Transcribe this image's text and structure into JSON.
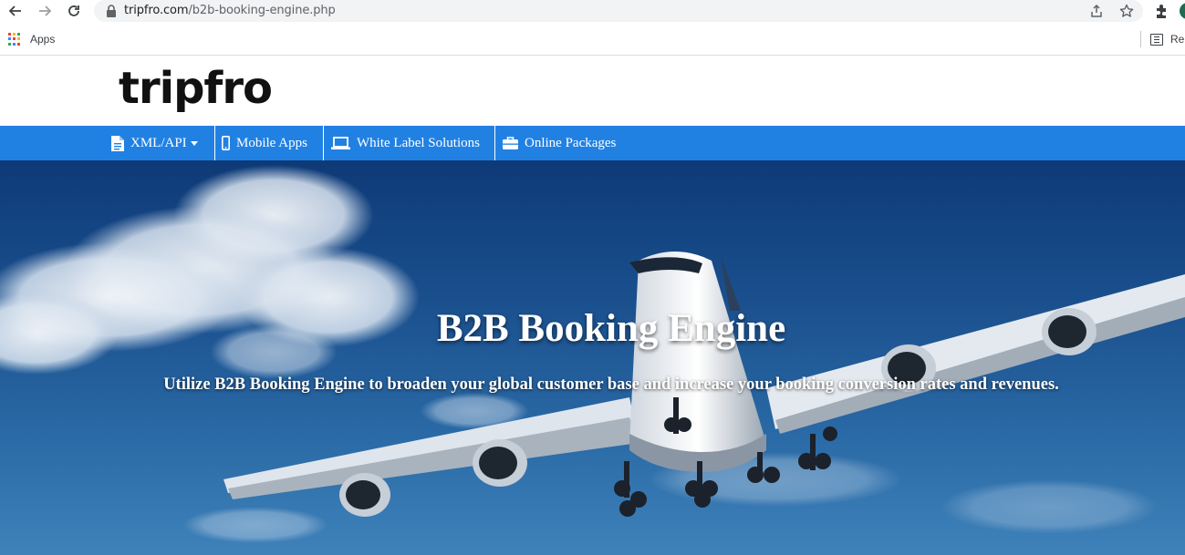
{
  "browser": {
    "url_host": "tripfro.com",
    "url_path": "/b2b-booking-engine.php",
    "bookmarks": {
      "apps_label": "Apps",
      "reading_list_label": "Re"
    },
    "icons": [
      "back-icon",
      "forward-icon",
      "reload-icon",
      "lock-icon",
      "share-icon",
      "star-icon",
      "extensions-icon",
      "apps-grid-icon",
      "reading-list-icon"
    ]
  },
  "site": {
    "logo": "tripfro",
    "nav": [
      {
        "label": "XML/API",
        "icon": "document-icon",
        "has_dropdown": true
      },
      {
        "label": "Mobile Apps",
        "icon": "mobile-icon"
      },
      {
        "label": "White Label Solutions",
        "icon": "laptop-icon"
      },
      {
        "label": "Online Packages",
        "icon": "briefcase-icon"
      }
    ],
    "colors": {
      "nav_bg": "#2181e3",
      "logo": "#111111"
    }
  },
  "hero": {
    "title": "B2B Booking Engine",
    "subtitle": "Utilize B2B Booking Engine to broaden your global customer base and increase your booking conversion rates and revenues."
  }
}
